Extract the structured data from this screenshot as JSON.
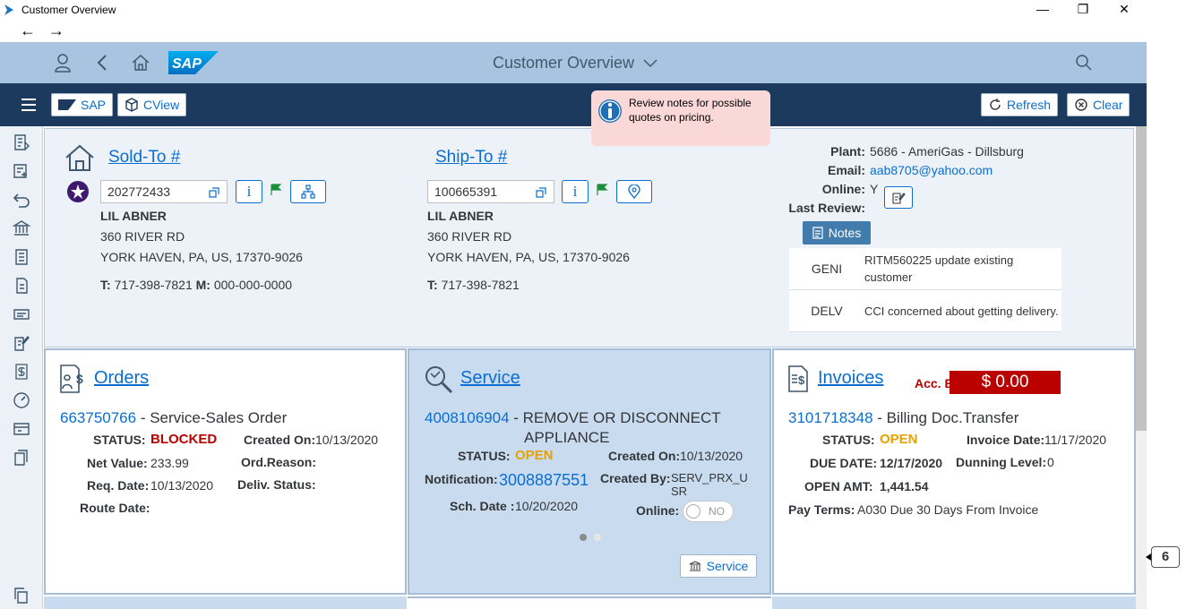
{
  "window": {
    "title": "Customer Overview",
    "minimize": "—",
    "maximize": "❐",
    "close": "✕",
    "back": "←",
    "forward": "→"
  },
  "shell": {
    "title": "Customer Overview",
    "logo_text": "SAP"
  },
  "toolbar": {
    "sap_label": "SAP",
    "cview_label": "CView",
    "refresh_label": "Refresh",
    "clear_label": "Clear"
  },
  "tooltip": {
    "text": "Review notes for possible quotes on pricing."
  },
  "sold_to": {
    "heading": "Sold-To #",
    "number": "202772433",
    "name": "LIL ABNER",
    "street": "360 RIVER RD",
    "city": "YORK HAVEN, PA, US, 17370-9026",
    "phone_label": "T:",
    "phone": "717-398-7821",
    "mobile_label": "M:",
    "mobile": "000-000-0000"
  },
  "ship_to": {
    "heading": "Ship-To #",
    "number": "100665391",
    "name": "LIL ABNER",
    "street": "360 RIVER RD",
    "city": "YORK HAVEN, PA, US, 17370-9026",
    "phone_label": "T:",
    "phone": "717-398-7821"
  },
  "customer_info": {
    "plant_label": "Plant:",
    "plant": "5686 - AmeriGas - Dillsburg",
    "email_label": "Email:",
    "email": "aab8705@yahoo.com",
    "online_label": "Online:",
    "online": "Y",
    "last_review_label": "Last Review:",
    "notes_button": "Notes"
  },
  "notes": [
    {
      "code": "GENI",
      "text": "RITM560225 update existing customer"
    },
    {
      "code": "DELV",
      "text": "CCI concerned about getting delivery."
    }
  ],
  "orders": {
    "title": "Orders",
    "doc_number": "663750766",
    "doc_type": " - Service-Sales Order",
    "status_label": "STATUS:",
    "status": "BLOCKED",
    "created_on_label": "Created On:",
    "created_on": "10/13/2020",
    "net_value_label": "Net Value:",
    "net_value": "233.99",
    "ord_reason_label": "Ord.Reason:",
    "ord_reason": "",
    "req_date_label": "Req. Date:",
    "req_date": "10/13/2020",
    "deliv_status_label": "Deliv. Status:",
    "deliv_status": "",
    "route_date_label": "Route Date:",
    "route_date": ""
  },
  "service": {
    "title": "Service",
    "doc_number": "4008106904",
    "doc_type_line1": " - REMOVE OR DISCONNECT",
    "doc_type_line2": "APPLIANCE",
    "status_label": "STATUS:",
    "status": "OPEN",
    "created_on_label": "Created On:",
    "created_on": "10/13/2020",
    "notification_label": "Notification:",
    "notification": "3008887551",
    "created_by_label": "Created By:",
    "created_by_line1": "SERV_PRX_U",
    "created_by_line2": "SR",
    "sch_date_label": "Sch. Date :",
    "sch_date": "10/20/2020",
    "online_label": "Online:",
    "online_toggle": "NO",
    "service_button": "Service"
  },
  "invoices": {
    "title": "Invoices",
    "acc_bal_label": "Acc. Bal Due:",
    "acc_bal": "$ 0.00",
    "doc_number": "3101718348",
    "doc_type": " - Billing Doc.Transfer",
    "status_label": "STATUS:",
    "status": "OPEN",
    "invoice_date_label": "Invoice Date:",
    "invoice_date": "11/17/2020",
    "due_date_label": "DUE DATE:",
    "due_date": "12/17/2020",
    "dunning_label": "Dunning Level:",
    "dunning": "0",
    "open_amt_label": "OPEN AMT:",
    "open_amt": "1,441.54",
    "pay_terms_label": "Pay Terms:",
    "pay_terms": "A030 Due 30 Days From Invoice"
  },
  "badge": {
    "count": "6"
  },
  "colors": {
    "shell": "#a9c4e0",
    "toolbar": "#1c3a5e",
    "link": "#0a6ed1",
    "blocked": "#bb0000",
    "open": "#e9a000"
  }
}
